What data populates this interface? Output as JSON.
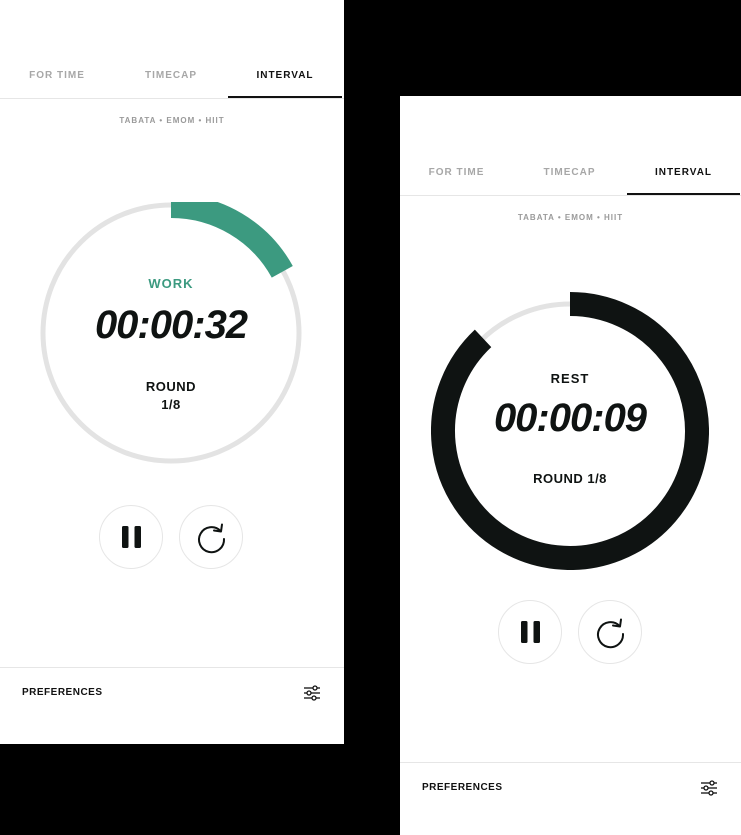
{
  "colors": {
    "accent_work": "#3c9a80",
    "dark": "#0f1312",
    "track": "#e3e3e3",
    "tab_inactive": "#a7a7a7"
  },
  "screens": [
    {
      "tabs": [
        {
          "label": "FOR TIME",
          "active": false
        },
        {
          "label": "TIMECAP",
          "active": false
        },
        {
          "label": "INTERVAL",
          "active": true
        }
      ],
      "subtitle": "TABATA • EMOM • HIIT",
      "timer": {
        "phase": "WORK",
        "time": "00:00:32",
        "round_label": "ROUND",
        "round_value": "1/8",
        "progress_fraction": 0.17
      },
      "controls": {
        "pause_icon": "pause-icon",
        "reset_icon": "reset-icon"
      },
      "preferences": {
        "label": "PREFERENCES",
        "icon": "sliders-icon"
      }
    },
    {
      "tabs": [
        {
          "label": "FOR TIME",
          "active": false
        },
        {
          "label": "TIMECAP",
          "active": false
        },
        {
          "label": "INTERVAL",
          "active": true
        }
      ],
      "subtitle": "TABATA • EMOM • HIIT",
      "timer": {
        "phase": "REST",
        "time": "00:00:09",
        "round_label": "ROUND 1/8",
        "progress_fraction": 0.88
      },
      "controls": {
        "pause_icon": "pause-icon",
        "reset_icon": "reset-icon"
      },
      "preferences": {
        "label": "PREFERENCES",
        "icon": "sliders-icon"
      }
    }
  ]
}
